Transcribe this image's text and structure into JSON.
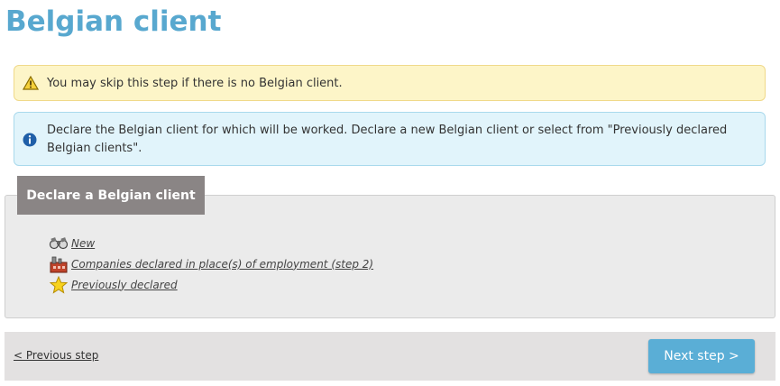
{
  "page": {
    "title": "Belgian client"
  },
  "alerts": {
    "warning": {
      "icon": "warning-icon",
      "text": "You may skip this step if there is no Belgian client."
    },
    "info": {
      "icon": "info-icon",
      "text": "Declare the Belgian client for which will be worked. Declare a new Belgian client or select from \"Previously declared Belgian clients\"."
    }
  },
  "panel": {
    "title": "Declare a Belgian client",
    "options": [
      {
        "label": "New",
        "icon": "binoculars-icon"
      },
      {
        "label": "Companies declared in place(s) of employment (step 2)",
        "icon": "factory-icon"
      },
      {
        "label": "Previously declared",
        "icon": "star-icon"
      }
    ]
  },
  "footer": {
    "previous_label": "< Previous step",
    "next_label": "Next step >"
  },
  "colors": {
    "title": "#58a8cf",
    "warning_bg": "#fdf5c8",
    "info_bg": "#e1f4fb",
    "tab_bg": "#8a8585",
    "button_bg": "#5aaed6"
  }
}
